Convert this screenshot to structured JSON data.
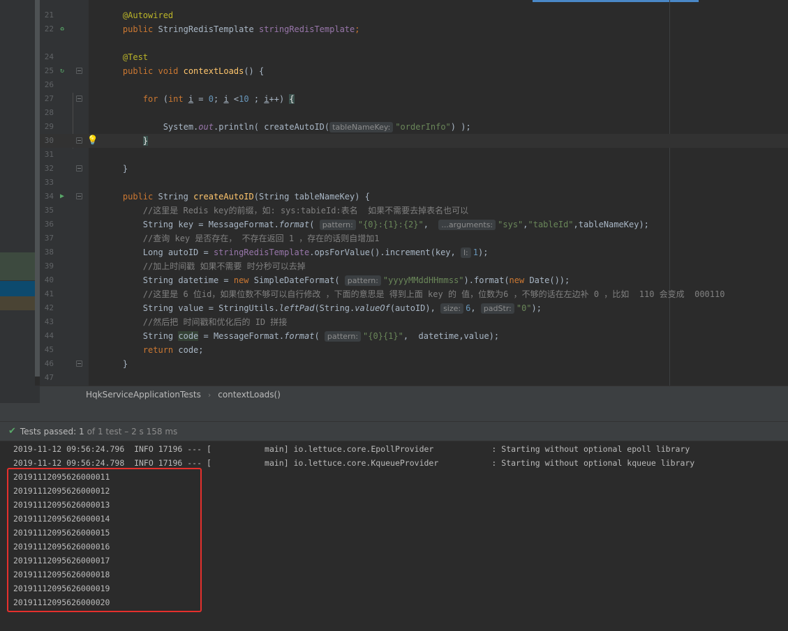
{
  "editor": {
    "lines": [
      {
        "n": "21",
        "tokens": [
          {
            "t": "    "
          },
          {
            "t": "@Autowired",
            "c": "an"
          }
        ]
      },
      {
        "n": "22",
        "icon": "bean-icon",
        "tokens": [
          {
            "t": "    "
          },
          {
            "t": "public ",
            "c": "kw"
          },
          {
            "t": "StringRedisTemplate "
          },
          {
            "t": "stringRedisTemplate",
            "c": "fld"
          },
          {
            "t": ";",
            "c": "kw"
          }
        ]
      },
      {
        "n": "24",
        "tokens": [
          {
            "t": "    "
          },
          {
            "t": "@Test",
            "c": "an"
          }
        ]
      },
      {
        "n": "25",
        "icon": "run-test-icon",
        "fold": true,
        "tokens": [
          {
            "t": "    "
          },
          {
            "t": "public void ",
            "c": "kw"
          },
          {
            "t": "contextLoads",
            "c": "fn"
          },
          {
            "t": "() {"
          }
        ]
      },
      {
        "n": "26",
        "tokens": []
      },
      {
        "n": "27",
        "fold": true,
        "tokens": [
          {
            "t": "        "
          },
          {
            "t": "for ",
            "c": "kw"
          },
          {
            "t": "("
          },
          {
            "t": "int ",
            "c": "kw"
          },
          {
            "t": "i",
            "c": "ul"
          },
          {
            "t": " = "
          },
          {
            "t": "0",
            "c": "num"
          },
          {
            "t": "; "
          },
          {
            "t": "i",
            "c": "ul"
          },
          {
            "t": " <"
          },
          {
            "t": "10",
            "c": "num"
          },
          {
            "t": " ; "
          },
          {
            "t": "i",
            "c": "ul"
          },
          {
            "t": "++) "
          },
          {
            "t": "{",
            "c": "brace"
          }
        ]
      },
      {
        "n": "28",
        "tokens": []
      },
      {
        "n": "29",
        "tokens": [
          {
            "t": "            System."
          },
          {
            "t": "out",
            "c": "fldi"
          },
          {
            "t": ".println( createAutoID("
          },
          {
            "h": "tableNameKey:"
          },
          {
            "t": "\"orderInfo\"",
            "c": "str"
          },
          {
            "t": ") );"
          }
        ]
      },
      {
        "n": "30",
        "current": true,
        "fold": true,
        "bulb": true,
        "tokens": [
          {
            "t": "        "
          },
          {
            "t": "}",
            "c": "brace"
          }
        ]
      },
      {
        "n": "31",
        "tokens": []
      },
      {
        "n": "32",
        "fold": true,
        "tokens": [
          {
            "t": "    }"
          }
        ]
      },
      {
        "n": "33",
        "tokens": []
      },
      {
        "n": "34",
        "icon": "run-icon",
        "fold": true,
        "tokens": [
          {
            "t": "    "
          },
          {
            "t": "public ",
            "c": "kw"
          },
          {
            "t": "String "
          },
          {
            "t": "createAutoID",
            "c": "fn"
          },
          {
            "t": "(String tableNameKey) {"
          }
        ]
      },
      {
        "n": "35",
        "tokens": [
          {
            "t": "        "
          },
          {
            "t": "//这里是 Redis key的前缀，如: sys:tabieId:表名  如果不需要去掉表名也可以",
            "c": "cmt"
          }
        ]
      },
      {
        "n": "36",
        "tokens": [
          {
            "t": "        String key = MessageFormat."
          },
          {
            "t": "format",
            "c": "it"
          },
          {
            "t": "( "
          },
          {
            "h": "pattern:"
          },
          {
            "t": "\"{0}:{1}:{2}\"",
            "c": "str"
          },
          {
            "t": ",  "
          },
          {
            "h": "...arguments:"
          },
          {
            "t": "\"sys\"",
            "c": "str"
          },
          {
            "t": ","
          },
          {
            "t": "\"tableId\"",
            "c": "str"
          },
          {
            "t": ",tableNameKey);"
          }
        ]
      },
      {
        "n": "37",
        "tokens": [
          {
            "t": "        "
          },
          {
            "t": "//查询 key 是否存在， 不存在返回 1 ，存在的话则自增加1",
            "c": "cmt"
          }
        ]
      },
      {
        "n": "38",
        "tokens": [
          {
            "t": "        Long autoID = "
          },
          {
            "t": "stringRedisTemplate",
            "c": "fld"
          },
          {
            "t": ".opsForValue().increment(key, "
          },
          {
            "h": "l:"
          },
          {
            "t": "1",
            "c": "num"
          },
          {
            "t": ");"
          }
        ]
      },
      {
        "n": "39",
        "tokens": [
          {
            "t": "        "
          },
          {
            "t": "//加上时间戳 如果不需要 时分秒可以去掉",
            "c": "cmt"
          }
        ]
      },
      {
        "n": "40",
        "tokens": [
          {
            "t": "        String datetime = "
          },
          {
            "t": "new ",
            "c": "kw"
          },
          {
            "t": "SimpleDateFormat( "
          },
          {
            "h": "pattern:"
          },
          {
            "t": "\"yyyyMMddHHmmss\"",
            "c": "str"
          },
          {
            "t": ").format("
          },
          {
            "t": "new ",
            "c": "kw"
          },
          {
            "t": "Date());"
          }
        ]
      },
      {
        "n": "41",
        "tokens": [
          {
            "t": "        "
          },
          {
            "t": "//这里是 6 位id，如果位数不够可以自行修改 ，下面的意思是 得到上面 key 的 值，位数为6 ，不够的话在左边补 0 ，比如  110 会变成  000110",
            "c": "cmt"
          }
        ]
      },
      {
        "n": "42",
        "tokens": [
          {
            "t": "        String value = StringUtils."
          },
          {
            "t": "leftPad",
            "c": "it"
          },
          {
            "t": "(String."
          },
          {
            "t": "valueOf",
            "c": "it"
          },
          {
            "t": "(autoID), "
          },
          {
            "h": "size:"
          },
          {
            "t": "6",
            "c": "num"
          },
          {
            "t": ", "
          },
          {
            "h": "padStr:"
          },
          {
            "t": "\"0\"",
            "c": "str"
          },
          {
            "t": ");"
          }
        ]
      },
      {
        "n": "43",
        "tokens": [
          {
            "t": "        "
          },
          {
            "t": "//然后把 时间戳和优化后的 ID 拼接",
            "c": "cmt"
          }
        ]
      },
      {
        "n": "44",
        "tokens": [
          {
            "t": "        String "
          },
          {
            "t": "code",
            "c": "hlw"
          },
          {
            "t": " = MessageFormat."
          },
          {
            "t": "format",
            "c": "it"
          },
          {
            "t": "( "
          },
          {
            "h": "pattern:"
          },
          {
            "t": "\"{0}{1}\"",
            "c": "str"
          },
          {
            "t": ",  datetime,value);"
          }
        ]
      },
      {
        "n": "45",
        "tokens": [
          {
            "t": "        "
          },
          {
            "t": "return ",
            "c": "kw"
          },
          {
            "t": "code;"
          }
        ]
      },
      {
        "n": "46",
        "fold": true,
        "tokens": [
          {
            "t": "    }"
          }
        ]
      },
      {
        "n": "47",
        "tokens": []
      }
    ]
  },
  "breadcrumb": {
    "class_name": "HqkServiceApplicationTests",
    "method_name": "contextLoads()"
  },
  "test_status": {
    "label": "Tests passed:",
    "passed": "1",
    "rest": "of 1 test – 2 s 158 ms"
  },
  "console": {
    "log_lines": [
      "2019-11-12 09:56:24.796  INFO 17196 --- [           main] io.lettuce.core.EpollProvider            : Starting without optional epoll library",
      "2019-11-12 09:56:24.798  INFO 17196 --- [           main] io.lettuce.core.KqueueProvider           : Starting without optional kqueue library"
    ],
    "ids": [
      "20191112095626000011",
      "20191112095626000012",
      "20191112095626000013",
      "20191112095626000014",
      "20191112095626000015",
      "20191112095626000016",
      "20191112095626000017",
      "20191112095626000018",
      "20191112095626000019",
      "20191112095626000020"
    ]
  },
  "colors": {
    "highlight_box": "#e5302d",
    "tests_passed": "#59a869"
  }
}
